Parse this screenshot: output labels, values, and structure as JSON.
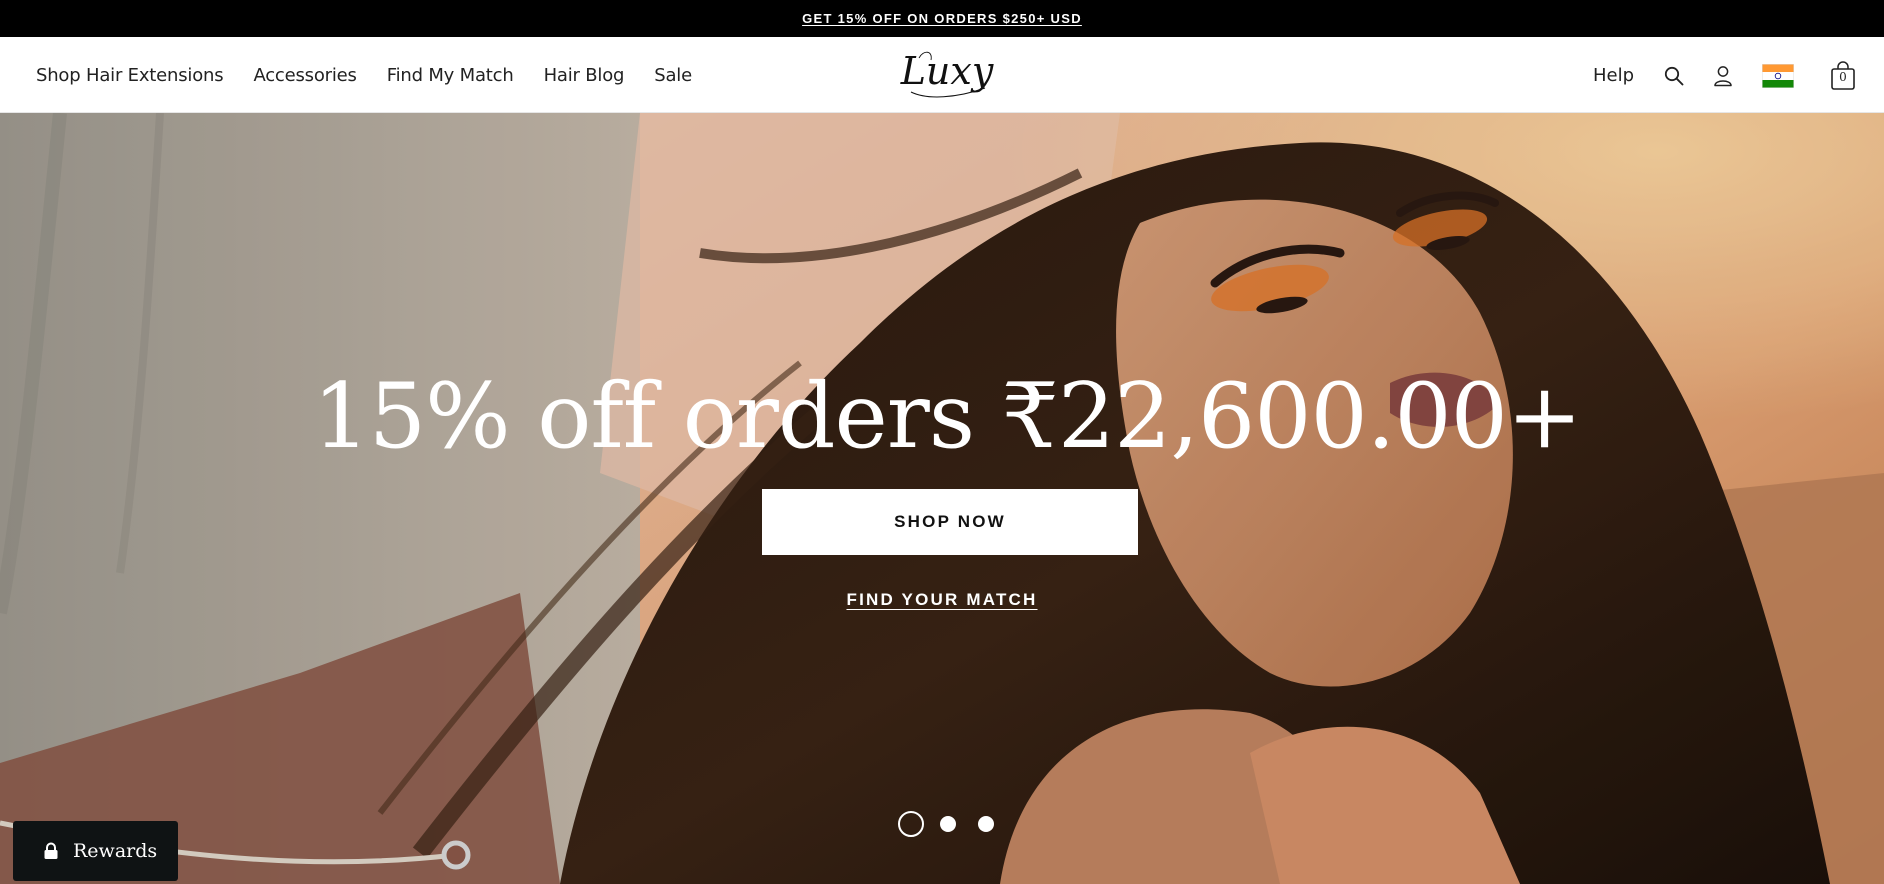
{
  "announcement": {
    "text": "GET 15% OFF ON ORDERS $250+ USD"
  },
  "header": {
    "nav": [
      "Shop Hair Extensions",
      "Accessories",
      "Find My Match",
      "Hair Blog",
      "Sale"
    ],
    "logo_text": "Luxy",
    "help_label": "Help",
    "cart_count": "0",
    "icons": {
      "search": "search-icon",
      "account": "account-icon",
      "country": "india-flag-icon",
      "cart": "shopping-bag-icon"
    }
  },
  "hero": {
    "heading": "15% off orders ₹22,600.00+",
    "primary_cta": "SHOP NOW",
    "secondary_cta": "FIND YOUR MATCH",
    "slides_total": 3,
    "active_slide": 1
  },
  "rewards": {
    "label": "Rewards",
    "icon": "lock-icon"
  },
  "colors": {
    "announcement_bg": "#000000",
    "header_bg": "#ffffff",
    "text": "#222222",
    "rewards_bg": "#0f1314",
    "flag_saffron": "#ff9933",
    "flag_green": "#138808",
    "flag_chakra": "#000080"
  }
}
